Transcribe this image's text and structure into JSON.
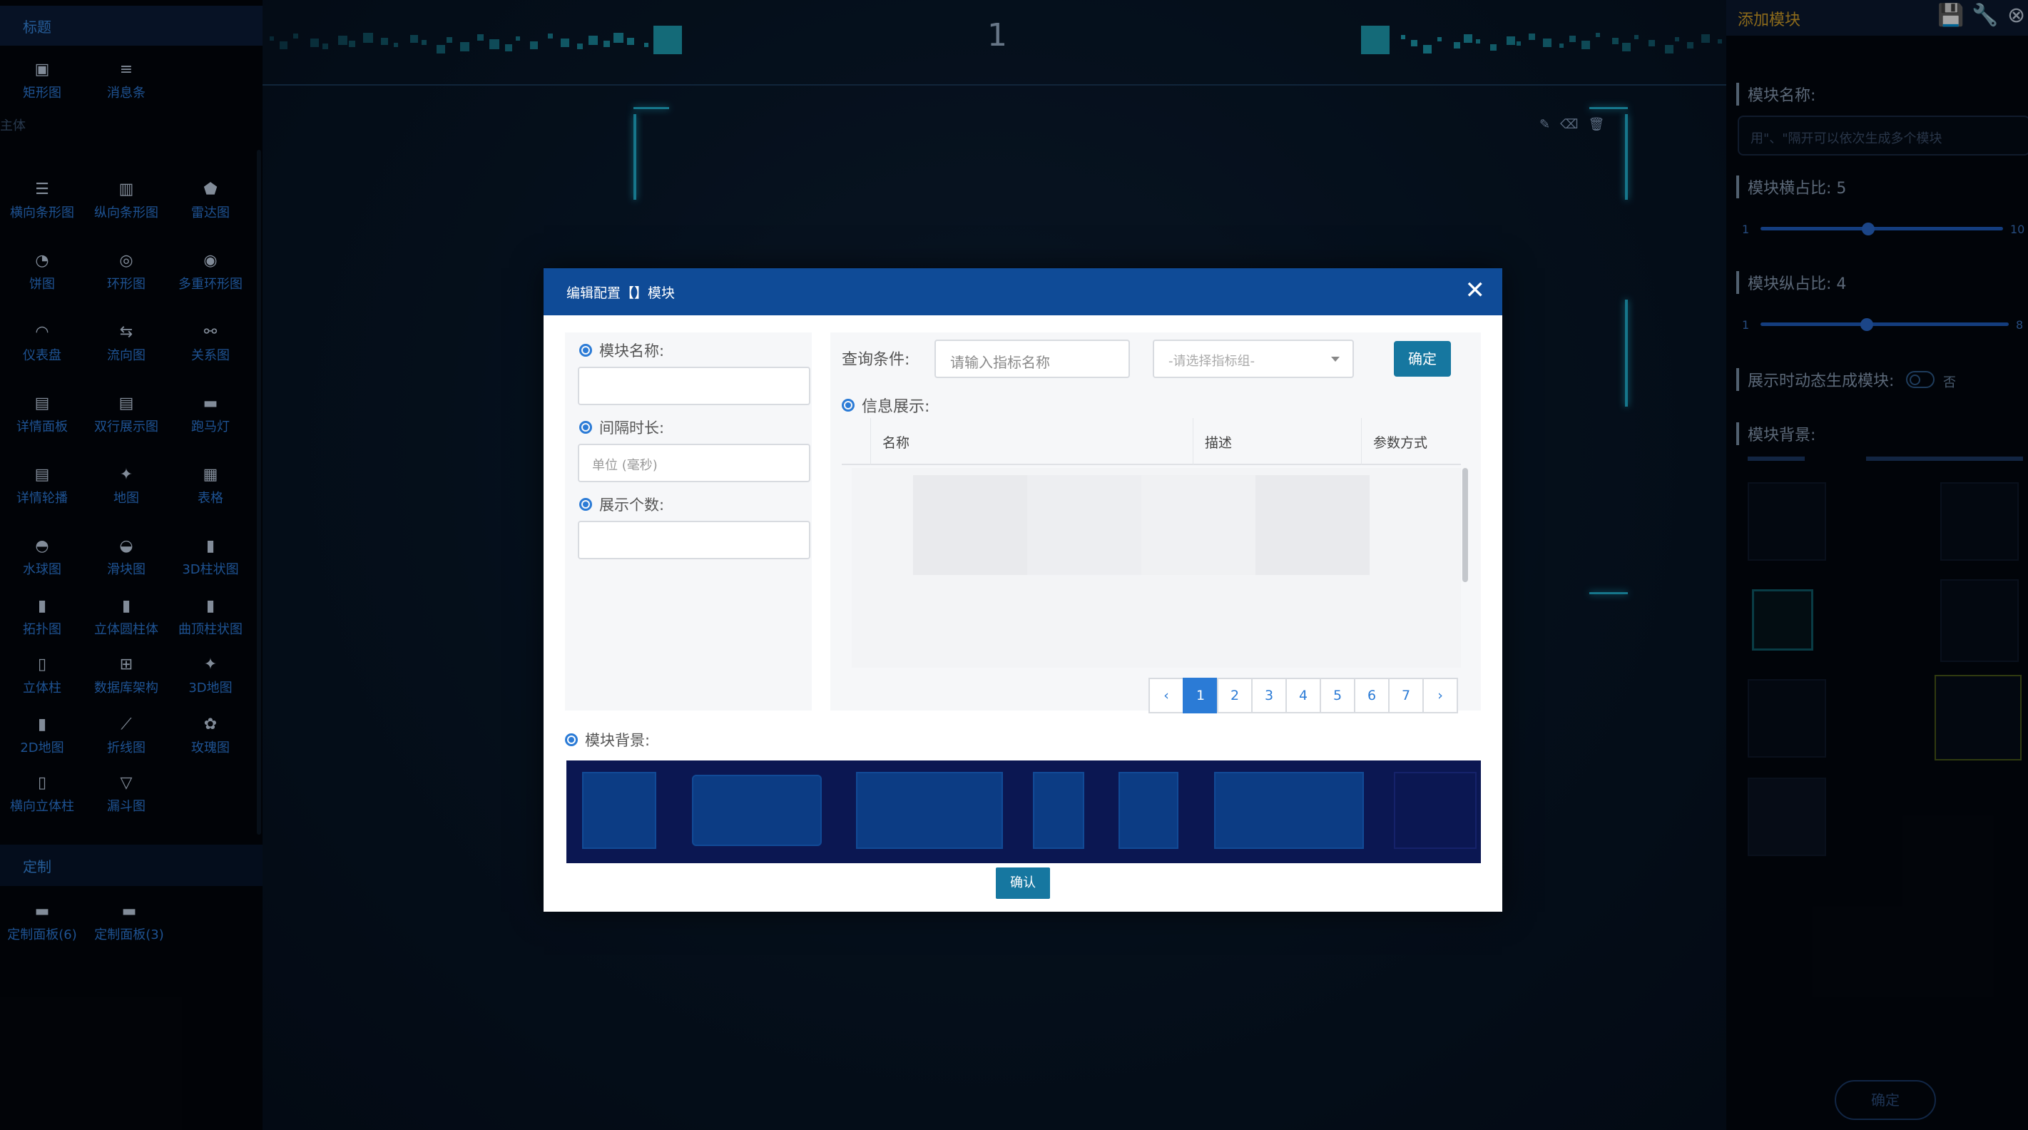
{
  "sidebar": {
    "title_section": "标题",
    "title_items": [
      {
        "label": "矩形图",
        "icon": "rect-chart-icon"
      },
      {
        "label": "消息条",
        "icon": "message-bar-icon"
      }
    ],
    "body_section": "主体",
    "body_items": [
      {
        "label": "横向条形图",
        "icon": "horizontal-bar-icon"
      },
      {
        "label": "纵向条形图",
        "icon": "vertical-bar-icon"
      },
      {
        "label": "雷达图",
        "icon": "radar-icon"
      },
      {
        "label": "饼图",
        "icon": "pie-icon"
      },
      {
        "label": "环形图",
        "icon": "ring-icon"
      },
      {
        "label": "多重环形图",
        "icon": "multi-ring-icon"
      },
      {
        "label": "仪表盘",
        "icon": "gauge-icon"
      },
      {
        "label": "流向图",
        "icon": "flow-icon"
      },
      {
        "label": "关系图",
        "icon": "relation-icon"
      },
      {
        "label": "详情面板",
        "icon": "detail-panel-icon"
      },
      {
        "label": "双行展示图",
        "icon": "double-row-icon"
      },
      {
        "label": "跑马灯",
        "icon": "marquee-icon"
      },
      {
        "label": "详情轮播",
        "icon": "carousel-icon"
      },
      {
        "label": "地图",
        "icon": "map-icon"
      },
      {
        "label": "表格",
        "icon": "table-icon"
      },
      {
        "label": "水球图",
        "icon": "liquid-icon"
      },
      {
        "label": "滑块图",
        "icon": "slider-chart-icon"
      },
      {
        "label": "3D柱状图",
        "icon": "3d-bar-icon"
      },
      {
        "label": "拓扑图",
        "icon": "topology-icon"
      },
      {
        "label": "立体圆柱体",
        "icon": "cylinder-icon"
      },
      {
        "label": "曲顶柱状图",
        "icon": "curved-bar-icon"
      },
      {
        "label": "立体柱",
        "icon": "solid-column-icon"
      },
      {
        "label": "数据库架构",
        "icon": "db-schema-icon"
      },
      {
        "label": "3D地图",
        "icon": "3d-map-icon"
      },
      {
        "label": "2D地图",
        "icon": "2d-map-icon"
      },
      {
        "label": "折线图",
        "icon": "line-chart-icon"
      },
      {
        "label": "玫瑰图",
        "icon": "rose-icon"
      },
      {
        "label": "横向立体柱",
        "icon": "h-solid-column-icon"
      },
      {
        "label": "漏斗图",
        "icon": "funnel-icon"
      }
    ],
    "custom_section": "定制",
    "custom_items": [
      {
        "label": "定制面板(6)",
        "icon": "custom-panel-icon"
      },
      {
        "label": "定制面板(3)",
        "icon": "custom-panel-icon"
      }
    ]
  },
  "canvas": {
    "page_number": "1"
  },
  "right_panel": {
    "title": "添加模块",
    "module_name_label": "模块名称:",
    "module_name_placeholder": "用\"、\"隔开可以依次生成多个模块",
    "h_ratio_label": "模块横占比: 5",
    "h_ratio_min": "1",
    "h_ratio_max": "10",
    "h_ratio_value": 5,
    "v_ratio_label": "模块纵占比: 4",
    "v_ratio_min": "1",
    "v_ratio_max": "8",
    "v_ratio_value": 4,
    "dynamic_label": "展示时动态生成模块:",
    "dynamic_value": "否",
    "background_label": "模块背景:",
    "confirm": "确定"
  },
  "modal": {
    "title": "编辑配置【】模块",
    "close": "✕",
    "name_label": "模块名称:",
    "interval_label": "间隔时长:",
    "interval_placeholder": "单位 (毫秒)",
    "count_label": "展示个数:",
    "query_label": "查询条件:",
    "query_placeholder": "请输入指标名称",
    "group_placeholder": "-请选择指标组-",
    "ok": "确定",
    "info_label": "信息展示:",
    "columns": [
      "名称",
      "描述",
      "参数方式"
    ],
    "pager": [
      "‹",
      "1",
      "2",
      "3",
      "4",
      "5",
      "6",
      "7",
      "›"
    ],
    "pager_active": "1",
    "bg_label": "模块背景:",
    "confirm": "确认"
  },
  "colors": {
    "accent": "#1677a0",
    "modal_header": "#0f4b97",
    "sidebar_text": "#2e7fe0",
    "right_title": "#d7a42a"
  }
}
